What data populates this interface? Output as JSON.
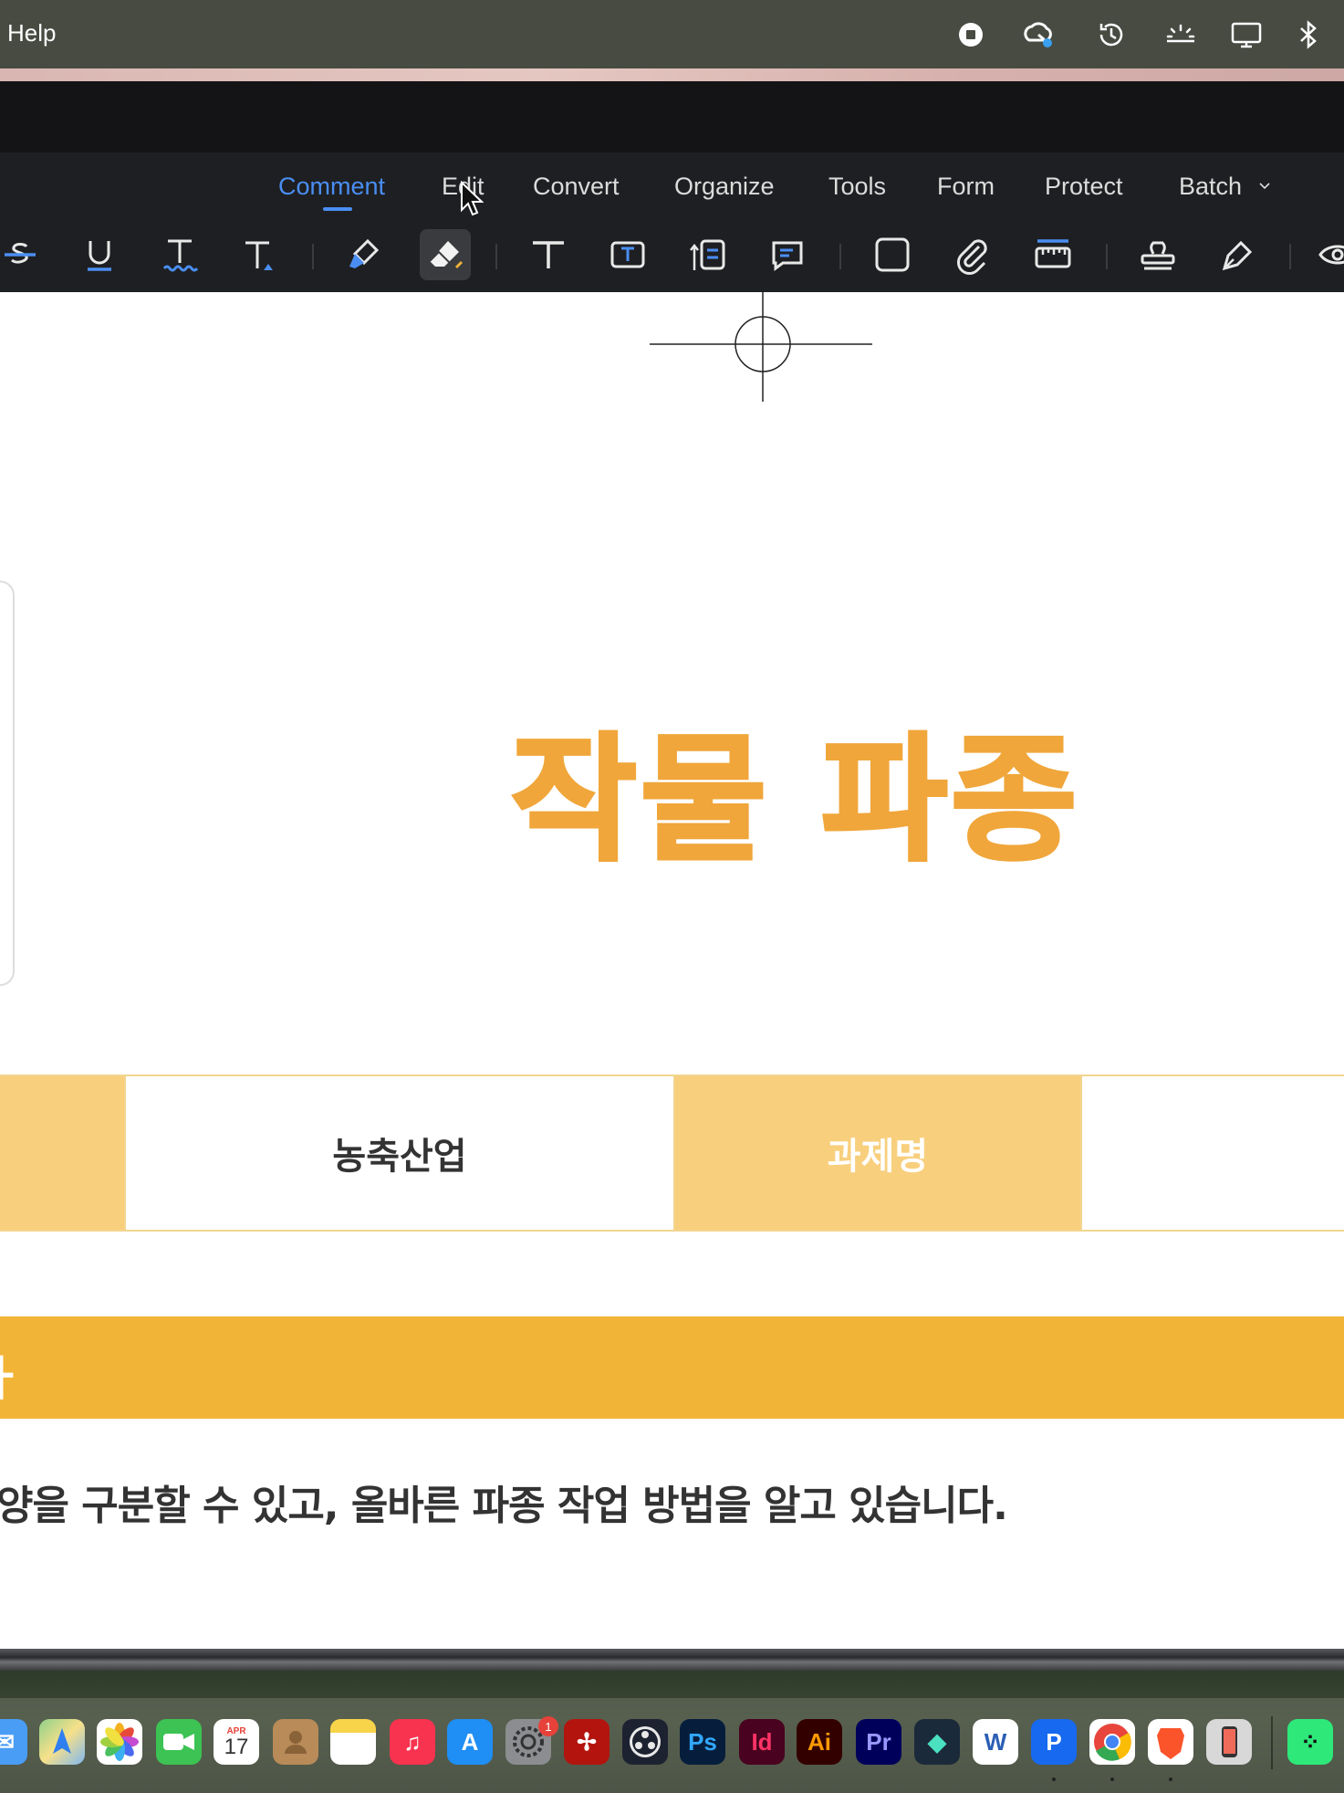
{
  "menubar": {
    "help_label": "Help",
    "status_icons": [
      "stop-record-icon",
      "creative-cloud-icon",
      "time-machine-icon",
      "brightness-icon",
      "display-icon",
      "bluetooth-icon"
    ]
  },
  "toolbar": {
    "tabs": [
      {
        "label": "Comment",
        "active": true
      },
      {
        "label": "Edit"
      },
      {
        "label": "Convert"
      },
      {
        "label": "Organize"
      },
      {
        "label": "Tools"
      },
      {
        "label": "Form"
      },
      {
        "label": "Protect"
      },
      {
        "label": "Batch"
      }
    ],
    "tools": [
      "strikethrough-icon",
      "underline-icon",
      "squiggly-underline-icon",
      "insert-text-icon",
      "highlighter-icon",
      "eraser-icon",
      "typewriter-icon",
      "text-box-icon",
      "callout-icon",
      "note-icon",
      "rectangle-icon",
      "attachment-icon",
      "measure-icon",
      "stamp-icon",
      "signature-icon",
      "eye-icon"
    ],
    "accent_color": "#4a8ef2"
  },
  "document": {
    "title": "작물 파종",
    "info_row": {
      "field_value": "농축산업",
      "project_label": "과제명"
    },
    "band_text": "ㅏ",
    "body_text": "양을 구분할 수 있고, 올바른 파종 작업 방법을 알고 있습니다.",
    "colors": {
      "title": "#f0a63a",
      "label_cell": "#f8cf7d",
      "band": "#f2b436"
    }
  },
  "dock": {
    "apps": [
      "Mail",
      "Maps",
      "Photos",
      "FaceTime",
      "Calendar",
      "Contacts",
      "Notes",
      "Music",
      "App Store",
      "System Settings",
      "Acrobat",
      "OBS",
      "Ps",
      "Id",
      "Ai",
      "Pr",
      "Filmora",
      "Word",
      "PDF Editor",
      "Chrome",
      "Brave",
      "iPhone Mirroring",
      "Terminal"
    ],
    "calendar": {
      "month": "APR",
      "day": "17"
    },
    "settings_badge": "1"
  }
}
